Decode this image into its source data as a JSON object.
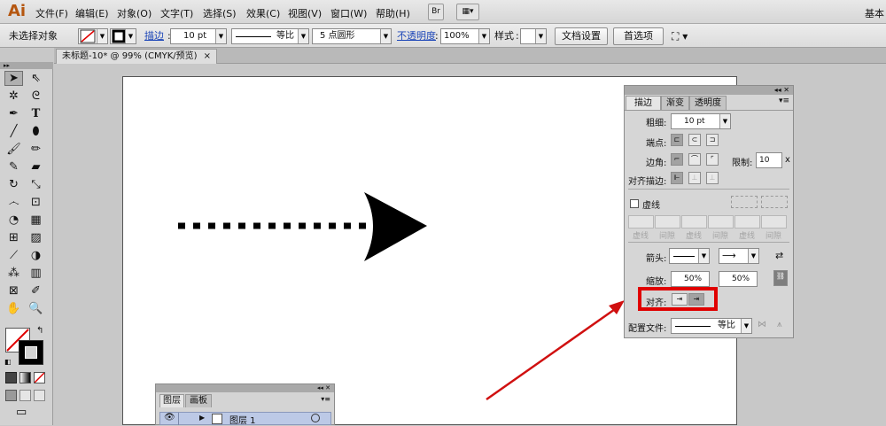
{
  "menubar": {
    "logo": "Ai",
    "items": [
      "文件(F)",
      "编辑(E)",
      "对象(O)",
      "文字(T)",
      "选择(S)",
      "效果(C)",
      "视图(V)",
      "窗口(W)",
      "帮助(H)"
    ],
    "bridge_btn": "Br",
    "right_text": "基本"
  },
  "control": {
    "selection_label": "未选择对象",
    "stroke_label": "描边",
    "stroke_weight": "10 pt",
    "profile": "等比",
    "brush": "5 点圆形",
    "opacity_label": "不透明度",
    "opacity": "100%",
    "style_label": "样式",
    "doc_setup": "文档设置",
    "prefs": "首选项"
  },
  "doc_tab": {
    "title": "未标题-10* @ 99% (CMYK/预览)",
    "close": "×"
  },
  "tools": [
    "selection-icon",
    "direct-selection-icon",
    "magic-wand-icon",
    "lasso-icon",
    "pen-icon",
    "type-icon",
    "line-icon",
    "ellipse-icon",
    "paintbrush-icon",
    "pencil-icon",
    "blob-brush-icon",
    "eraser-icon",
    "rotate-icon",
    "scale-icon",
    "warp-icon",
    "free-transform-icon",
    "shape-builder-icon",
    "perspective-grid-icon",
    "mesh-icon",
    "gradient-icon",
    "eyedropper-icon",
    "blend-icon",
    "symbol-sprayer-icon",
    "column-graph-icon",
    "artboard-icon",
    "slice-icon",
    "hand-icon",
    "zoom-icon"
  ],
  "stroke_panel": {
    "tabs": [
      "描边",
      "渐变",
      "透明度"
    ],
    "weight_label": "粗细:",
    "weight": "10 pt",
    "cap_label": "端点:",
    "corner_label": "边角:",
    "limit_label": "限制:",
    "limit": "10",
    "limit_unit": "x",
    "align_label": "对齐描边:",
    "dashed_label": "虚线",
    "dash_labels": [
      "虚线",
      "间隙",
      "虚线",
      "间隙",
      "虚线",
      "间隙"
    ],
    "arrow_label": "箭头:",
    "scale_label": "缩放:",
    "scale_start": "50%",
    "scale_end": "50%",
    "align_arrow_label": "对齐:",
    "profile_label": "配置文件:",
    "profile": "等比"
  },
  "layers_panel": {
    "tabs": [
      "图层",
      "画板"
    ],
    "layer_name": "图层 1"
  },
  "colors": {
    "highlight": "#e00000",
    "arrow": "#d01010"
  }
}
